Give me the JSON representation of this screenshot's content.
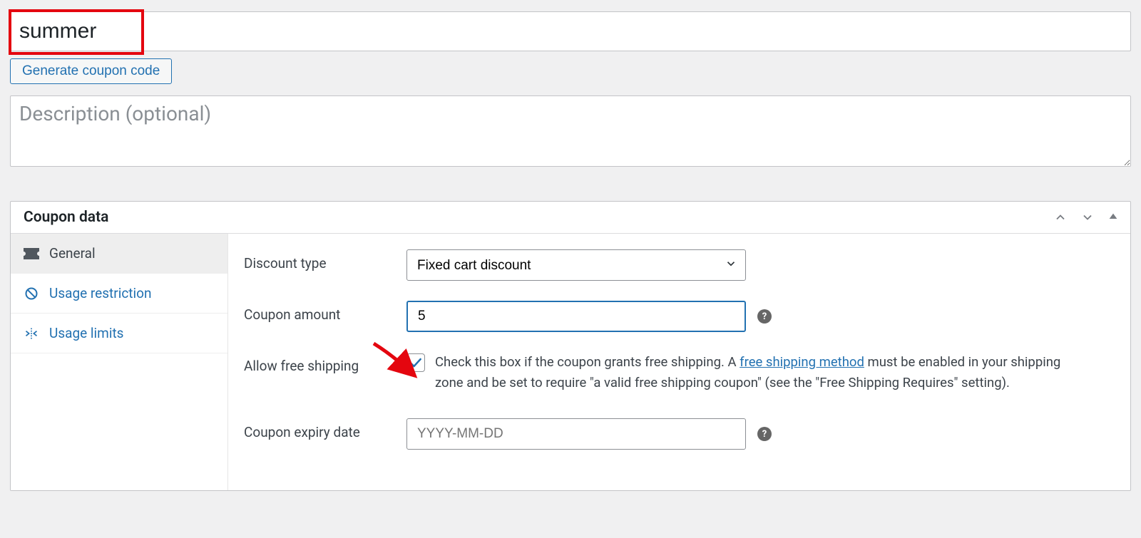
{
  "coupon_code_value": "summer",
  "generate_button_label": "Generate coupon code",
  "description_placeholder": "Description (optional)",
  "panel_title": "Coupon data",
  "tabs": {
    "general": "General",
    "usage_restriction": "Usage restriction",
    "usage_limits": "Usage limits"
  },
  "fields": {
    "discount_type_label": "Discount type",
    "discount_type_value": "Fixed cart discount",
    "coupon_amount_label": "Coupon amount",
    "coupon_amount_value": "5",
    "allow_free_shipping_label": "Allow free shipping",
    "free_shipping_text_before": "Check this box if the coupon grants free shipping. A ",
    "free_shipping_link_text": "free shipping method",
    "free_shipping_text_after": " must be enabled in your shipping zone and be set to require \"a valid free shipping coupon\" (see the \"Free Shipping Requires\" setting).",
    "coupon_expiry_label": "Coupon expiry date",
    "coupon_expiry_placeholder": "YYYY-MM-DD"
  }
}
